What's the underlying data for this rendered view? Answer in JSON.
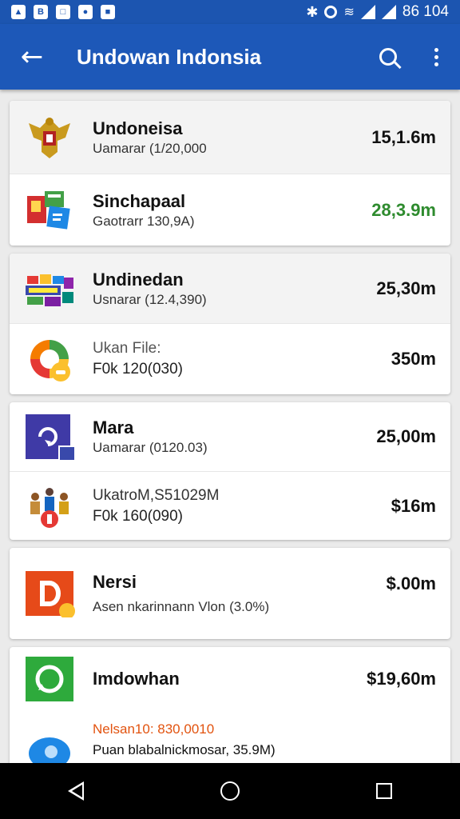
{
  "status_bar": {
    "time": "86 104"
  },
  "app_bar": {
    "title": "Undowan Indonsia"
  },
  "colors": {
    "primary": "#1d58b8",
    "positive": "#2e8b2e",
    "accent": "#e2530f"
  },
  "cards": [
    {
      "rows": [
        {
          "name": "Undoneisa",
          "sub": "Uamarar (1/20,000",
          "value": "15,1.6m",
          "icon": "garuda-emblem-icon"
        },
        {
          "name": "Sinchapaal",
          "sub": "Gaotrarr 130,9A)",
          "value": "28,3.9m",
          "icon": "flags-collage-icon"
        }
      ]
    },
    {
      "rows": [
        {
          "name": "Undinedan",
          "sub": "Usnarar (12.4,390)",
          "value": "25,30m",
          "icon": "banner-collage-icon"
        },
        {
          "name": "Ukan File:",
          "sub": "F0k 120(030)",
          "value": "350m",
          "icon": "color-ring-icon"
        }
      ]
    },
    {
      "rows": [
        {
          "name": "Mara",
          "sub": "Uamarar (0120.03)",
          "value": "25,00m",
          "icon": "sync-app-icon"
        },
        {
          "name": "UkatroM,S51029M",
          "sub": "F0k 160(090)",
          "value": "$16m",
          "icon": "people-group-icon"
        }
      ]
    },
    {
      "rows": [
        {
          "name": "Nersi",
          "sub": "Asen nkarinnann Vlon (3.0%)",
          "value": "$.00m",
          "icon": "d-app-icon"
        }
      ]
    },
    {
      "rows": [
        {
          "name": "Imdowhan",
          "value": "$19,60m",
          "icon": "chat-app-icon"
        },
        {
          "name": "Nelsan10: 830,0010",
          "sub": "Puan blabalnickmosar, 35.9M)",
          "icon": "blue-blob-icon"
        }
      ]
    }
  ]
}
